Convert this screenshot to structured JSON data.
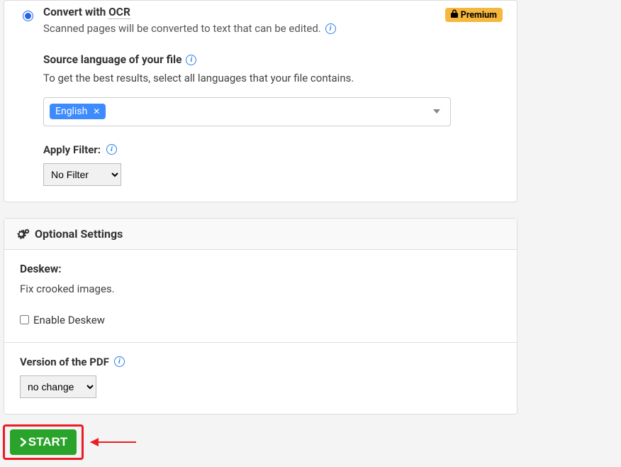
{
  "ocr": {
    "title_prefix": "Convert with ",
    "title_ocr": "OCR",
    "desc": "Scanned pages will be converted to text that can be edited.",
    "premium_label": "Premium",
    "source_lang_title": "Source language of your file",
    "source_lang_desc": "To get the best results, select all languages that your file contains.",
    "selected_language": "English",
    "filter_label": "Apply Filter:",
    "filter_value": "No Filter"
  },
  "optional": {
    "header": "Optional Settings",
    "deskew_label": "Deskew:",
    "deskew_desc": "Fix crooked images.",
    "enable_deskew_label": "Enable Deskew",
    "version_label": "Version of the PDF",
    "version_value": "no change"
  },
  "start_label": "START"
}
